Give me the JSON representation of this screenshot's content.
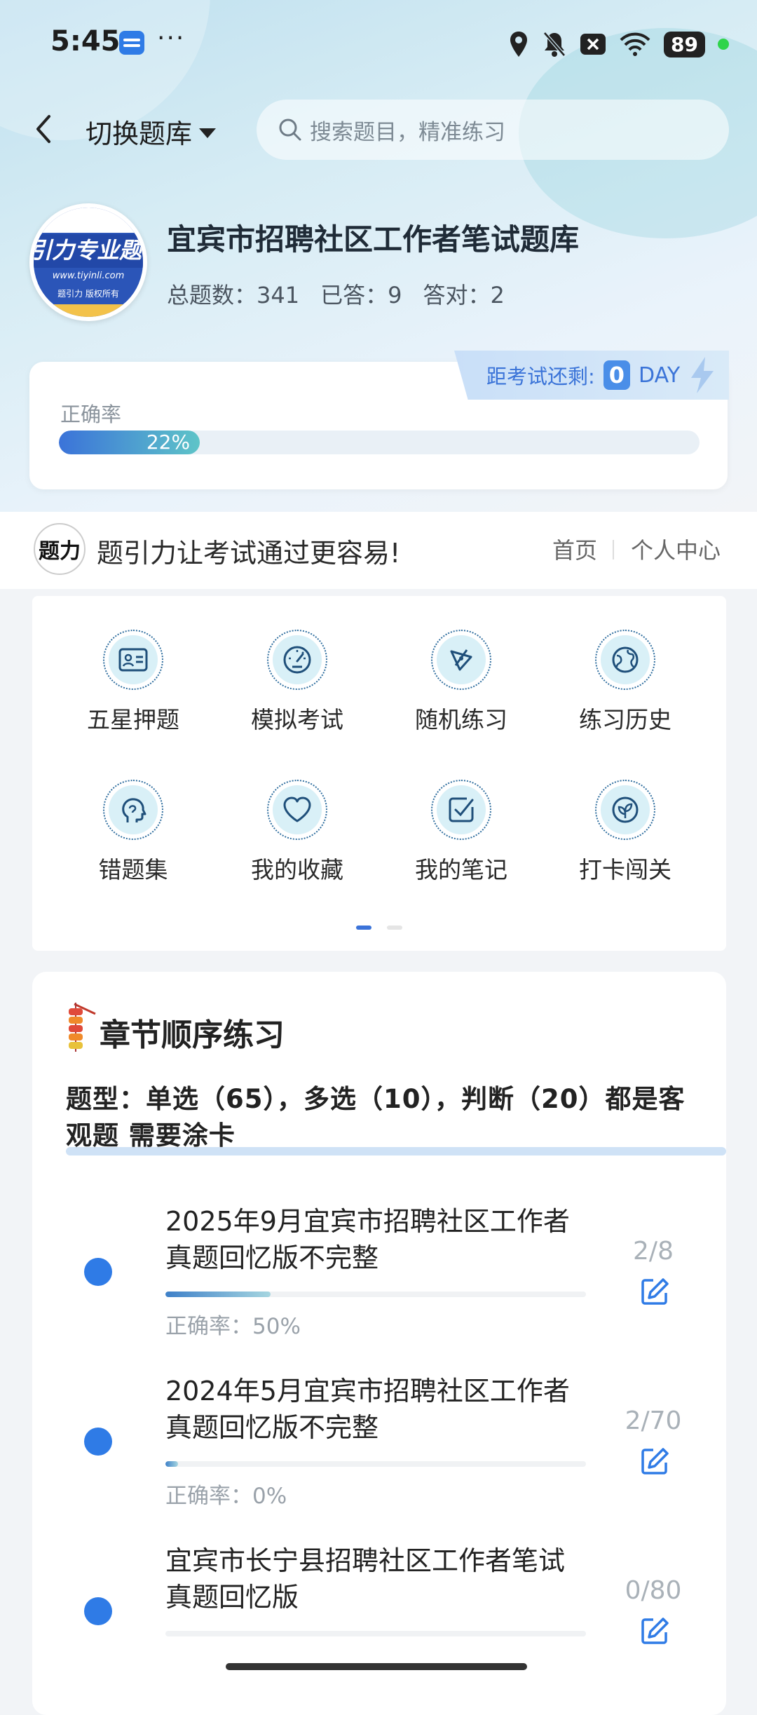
{
  "status_bar": {
    "time": "5:45",
    "more": "···",
    "battery": "89",
    "icons": [
      "app-icon",
      "location-icon",
      "mute-icon",
      "close-box-icon",
      "wifi-icon",
      "battery-icon"
    ]
  },
  "top_nav": {
    "switch_label": "切换题库",
    "search_placeholder": "搜索题目，精准练习"
  },
  "header": {
    "logo_text": "引力专业题",
    "logo_url": "www.tiyinli.com",
    "logo_copyright": "题引力 版权所有",
    "title": "宜宾市招聘社区工作者笔试题库",
    "total_label": "总题数：341",
    "answered_label": "已答：9",
    "correct_label": "答对：2"
  },
  "countdown": {
    "label": "距考试还剩:",
    "days": "0",
    "unit": "DAY"
  },
  "accuracy": {
    "label": "正确率",
    "percent_text": "22%",
    "value": 0.22
  },
  "slogan": {
    "logo_text": "题力",
    "text": "题引力让考试通过更容易!",
    "nav_home": "首页",
    "nav_center": "个人中心"
  },
  "functions": [
    {
      "label": "五星押题",
      "icon": "id-card-icon"
    },
    {
      "label": "模拟考试",
      "icon": "speedometer-icon"
    },
    {
      "label": "随机练习",
      "icon": "shuffle-icon"
    },
    {
      "label": "练习历史",
      "icon": "globe-icon"
    },
    {
      "label": "错题集",
      "icon": "head-icon"
    },
    {
      "label": "我的收藏",
      "icon": "heart-icon"
    },
    {
      "label": "我的笔记",
      "icon": "checkbox-icon"
    },
    {
      "label": "打卡闯关",
      "icon": "leaf-icon"
    }
  ],
  "chapter": {
    "title": "章节顺序练习",
    "qtype_text": "题型：单选（65），多选（10），判断（20）都是客观题 需要涂卡",
    "items": [
      {
        "title": "2025年9月宜宾市招聘社区工作者真题回忆版不完整",
        "count": "2/8",
        "accuracy": "正确率：50%",
        "progress": 0.25
      },
      {
        "title": "2024年5月宜宾市招聘社区工作者真题回忆版不完整",
        "count": "2/70",
        "accuracy": "正确率：0%",
        "progress": 0.03
      },
      {
        "title": "宜宾市长宁县招聘社区工作者笔试真题回忆版",
        "count": "0/80",
        "accuracy": "",
        "progress": 0
      }
    ]
  }
}
